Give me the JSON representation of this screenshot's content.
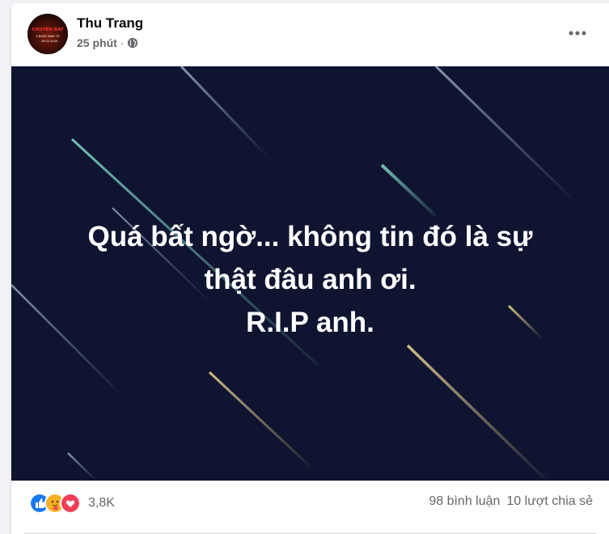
{
  "post": {
    "author": "Thu Trang",
    "time": "25 phút",
    "privacy_icon": "globe-icon",
    "more_icon": "more-options-icon",
    "avatar_text": [
      "CHUYẾN BAY",
      "3 NGÀY SINH TỬ",
      "29.02.2020"
    ],
    "image_caption": [
      "Quá bất ngờ... không tin đó là sự",
      "thật đâu anh ơi.",
      "R.I.P anh."
    ],
    "reactions": {
      "icons": [
        "like-reaction-icon",
        "care-reaction-icon",
        "love-reaction-icon"
      ],
      "count": "3,8K"
    },
    "comments": "98 bình luận",
    "shares": "10 lượt chia sẻ"
  },
  "colors": {
    "like": "#1877f2",
    "love": "#f33e58",
    "care": "#f7b125",
    "photo_bg": "#0f1430"
  }
}
